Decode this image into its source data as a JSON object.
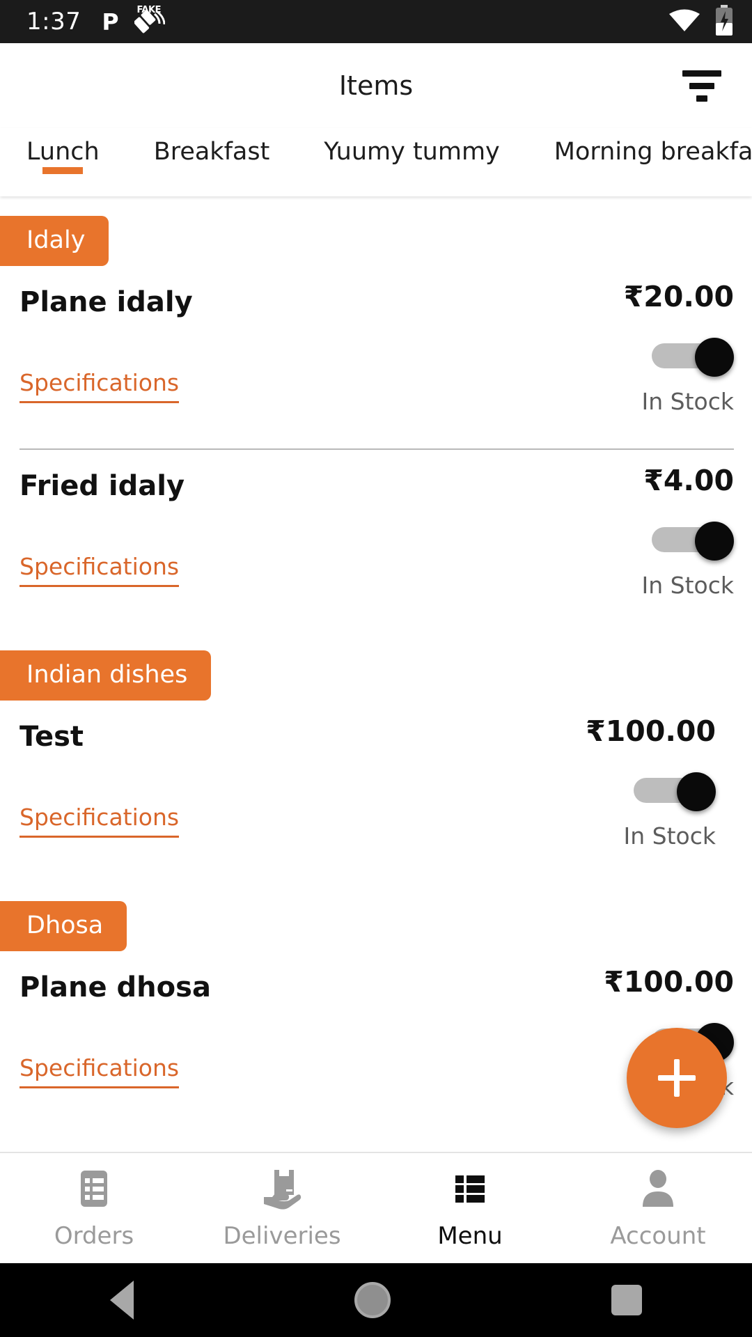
{
  "statusbar": {
    "time": "1:37",
    "left_icons": [
      {
        "name": "opera-p-icon",
        "glyph": "P"
      },
      {
        "name": "fake-gps-icon",
        "label": "FAKE"
      }
    ],
    "right_icons": [
      {
        "name": "wifi-icon"
      },
      {
        "name": "battery-charging-icon"
      }
    ]
  },
  "appbar": {
    "title": "Items",
    "filter_icon": "filter-icon"
  },
  "tabs": [
    {
      "label": "Lunch",
      "active": true
    },
    {
      "label": "Breakfast",
      "active": false
    },
    {
      "label": "Yuumy tummy",
      "active": false
    },
    {
      "label": "Morning breakfast",
      "active": false
    }
  ],
  "sections": [
    {
      "category": "Idaly",
      "items": [
        {
          "name": "Plane idaly",
          "price": "₹20.00",
          "spec_label": "Specifications",
          "stock_label": "In Stock",
          "in_stock": true
        },
        {
          "name": "Fried idaly",
          "price": "₹4.00",
          "spec_label": "Specifications",
          "stock_label": "In Stock",
          "in_stock": true
        }
      ]
    },
    {
      "category": "Indian dishes",
      "items": [
        {
          "name": "Test",
          "price": "₹100.00",
          "spec_label": "Specifications",
          "stock_label": "In Stock",
          "in_stock": true
        }
      ]
    },
    {
      "category": "Dhosa",
      "items": [
        {
          "name": "Plane dhosa",
          "price": "₹100.00",
          "spec_label": "Specifications",
          "stock_label": "In Stock",
          "in_stock": true
        }
      ]
    }
  ],
  "fab": {
    "icon": "plus-icon",
    "label": "+"
  },
  "bottomnav": [
    {
      "label": "Orders",
      "icon": "orders-list-icon",
      "active": false
    },
    {
      "label": "Deliveries",
      "icon": "package-hand-icon",
      "active": false
    },
    {
      "label": "Menu",
      "icon": "menu-grid-icon",
      "active": true
    },
    {
      "label": "Account",
      "icon": "person-icon",
      "active": false
    }
  ],
  "androidnav": [
    {
      "name": "back-button"
    },
    {
      "name": "home-button"
    },
    {
      "name": "recents-button"
    }
  ],
  "colors": {
    "accent": "#E8742C",
    "spec_link": "#D9662A",
    "statusbar_bg": "#1b1b1b",
    "toggle_track": "#bdbdbd",
    "toggle_thumb": "#0a0a0a",
    "muted_text": "#9a9a9a"
  }
}
